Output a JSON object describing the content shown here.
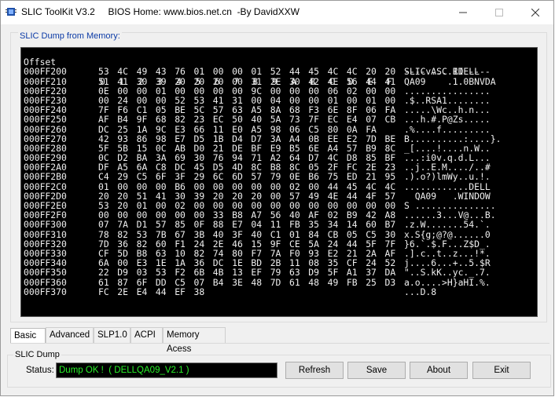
{
  "window": {
    "title": "SLIC ToolKit V3.2     BIOS Home: www.bios.net.cn  -By DavidXXW"
  },
  "dump_group": {
    "label": "SLIC Dump from Memory:"
  },
  "hex": {
    "header": {
      "offset": "Offset",
      "columns": [
        "0",
        "1",
        "2",
        "3",
        "4",
        "5",
        "6",
        "7",
        "8",
        "9",
        "A",
        "B",
        "C",
        "D",
        "E",
        "F"
      ],
      "ascii": "---- ASC II ----"
    },
    "rows": [
      {
        "offset": "000FF200",
        "bytes": [
          "53",
          "4C",
          "49",
          "43",
          "76",
          "01",
          "00",
          "00",
          "01",
          "52",
          "44",
          "45",
          "4C",
          "4C",
          "20",
          "20"
        ],
        "ascii": "SLICv....RDELL"
      },
      {
        "offset": "000FF210",
        "bytes": [
          "51",
          "41",
          "30",
          "39",
          "20",
          "20",
          "20",
          "00",
          "31",
          "2E",
          "30",
          "42",
          "4E",
          "56",
          "44",
          "41"
        ],
        "ascii": "QA09    .1.0BNVDA"
      },
      {
        "offset": "000FF220",
        "bytes": [
          "0E",
          "00",
          "00",
          "01",
          "00",
          "00",
          "00",
          "00",
          "9C",
          "00",
          "00",
          "00",
          "06",
          "02",
          "00",
          "00"
        ],
        "ascii": "................"
      },
      {
        "offset": "000FF230",
        "bytes": [
          "00",
          "24",
          "00",
          "00",
          "52",
          "53",
          "41",
          "31",
          "00",
          "04",
          "00",
          "00",
          "01",
          "00",
          "01",
          "00"
        ],
        "ascii": ".$..RSA1........"
      },
      {
        "offset": "000FF240",
        "bytes": [
          "7F",
          "F6",
          "C1",
          "05",
          "BE",
          "5C",
          "57",
          "63",
          "A5",
          "8A",
          "68",
          "F3",
          "6E",
          "8F",
          "06",
          "FA"
        ],
        "ascii": ".....\\Wc..h.n..."
      },
      {
        "offset": "000FF250",
        "bytes": [
          "AF",
          "B4",
          "9F",
          "68",
          "82",
          "23",
          "EC",
          "50",
          "40",
          "5A",
          "73",
          "7F",
          "EC",
          "E4",
          "07",
          "CB"
        ],
        "ascii": "...h.#.P@Zs....."
      },
      {
        "offset": "000FF260",
        "bytes": [
          "DC",
          "25",
          "1A",
          "9C",
          "E3",
          "66",
          "11",
          "E0",
          "A5",
          "98",
          "06",
          "C5",
          "80",
          "0A",
          "FA"
        ],
        "ascii": ".%....f........."
      },
      {
        "offset": "000FF270",
        "bytes": [
          "42",
          "93",
          "86",
          "98",
          "E7",
          "D5",
          "1B",
          "D4",
          "D7",
          "3A",
          "A4",
          "0B",
          "EE",
          "E2",
          "7D",
          "BE"
        ],
        "ascii": "B..........:....}."
      },
      {
        "offset": "000FF280",
        "bytes": [
          "5F",
          "5B",
          "15",
          "0C",
          "AB",
          "D0",
          "21",
          "DE",
          "BF",
          "E9",
          "B5",
          "6E",
          "A4",
          "57",
          "B9",
          "8C"
        ],
        "ascii": "_[....!....n.W.."
      },
      {
        "offset": "000FF290",
        "bytes": [
          "0C",
          "D2",
          "BA",
          "3A",
          "69",
          "30",
          "76",
          "94",
          "71",
          "A2",
          "64",
          "D7",
          "4C",
          "D8",
          "85",
          "BF"
        ],
        "ascii": "...:i0v.q.d.L..."
      },
      {
        "offset": "000FF2A0",
        "bytes": [
          "DF",
          "A5",
          "6A",
          "C8",
          "DC",
          "45",
          "D5",
          "4D",
          "8C",
          "B8",
          "8C",
          "05",
          "2F",
          "FC",
          "2E",
          "23"
        ],
        "ascii": "..j..E.M..../..#"
      },
      {
        "offset": "000FF2B0",
        "bytes": [
          "C4",
          "29",
          "C5",
          "6F",
          "3F",
          "29",
          "6C",
          "6D",
          "57",
          "79",
          "0E",
          "B6",
          "75",
          "ED",
          "21",
          "95"
        ],
        "ascii": ".).o?)lmWy..u.!."
      },
      {
        "offset": "000FF2C0",
        "bytes": [
          "01",
          "00",
          "00",
          "00",
          "B6",
          "00",
          "00",
          "00",
          "00",
          "00",
          "02",
          "00",
          "44",
          "45",
          "4C",
          "4C"
        ],
        "ascii": "............DELL"
      },
      {
        "offset": "000FF2D0",
        "bytes": [
          "20",
          "20",
          "51",
          "41",
          "30",
          "39",
          "20",
          "20",
          "20",
          "00",
          "57",
          "49",
          "4E",
          "44",
          "4F",
          "57"
        ],
        "ascii": "  QA09   .WINDOW"
      },
      {
        "offset": "000FF2E0",
        "bytes": [
          "53",
          "20",
          "01",
          "00",
          "02",
          "00",
          "00",
          "00",
          "00",
          "00",
          "00",
          "00",
          "00",
          "00",
          "00",
          "00"
        ],
        "ascii": "S ..............."
      },
      {
        "offset": "000FF2F0",
        "bytes": [
          "00",
          "00",
          "00",
          "00",
          "00",
          "00",
          "33",
          "B8",
          "A7",
          "56",
          "40",
          "AF",
          "02",
          "B9",
          "42",
          "A8"
        ],
        "ascii": "......3...V@...B."
      },
      {
        "offset": "000FF300",
        "bytes": [
          "07",
          "7A",
          "D1",
          "57",
          "85",
          "0F",
          "88",
          "E7",
          "04",
          "11",
          "FB",
          "35",
          "34",
          "14",
          "60",
          "B7"
        ],
        "ascii": ".z.W.......54.`."
      },
      {
        "offset": "000FF310",
        "bytes": [
          "78",
          "82",
          "53",
          "7B",
          "67",
          "3B",
          "40",
          "3F",
          "40",
          "C1",
          "01",
          "84",
          "CB",
          "05",
          "C5",
          "30"
        ],
        "ascii": "x.S{g;@?@......0"
      },
      {
        "offset": "000FF320",
        "bytes": [
          "7D",
          "36",
          "82",
          "60",
          "F1",
          "24",
          "2E",
          "46",
          "15",
          "9F",
          "CE",
          "5A",
          "24",
          "44",
          "5F",
          "7F"
        ],
        "ascii": "}6.`.$.F...Z$D_."
      },
      {
        "offset": "000FF330",
        "bytes": [
          "CF",
          "5D",
          "B8",
          "63",
          "10",
          "82",
          "74",
          "80",
          "F7",
          "7A",
          "F0",
          "93",
          "E2",
          "21",
          "2A",
          "AF"
        ],
        "ascii": ".].c..t..z...!*."
      },
      {
        "offset": "000FF340",
        "bytes": [
          "6A",
          "00",
          "E3",
          "1E",
          "1A",
          "36",
          "DC",
          "1E",
          "BD",
          "2B",
          "11",
          "08",
          "35",
          "CF",
          "24",
          "52"
        ],
        "ascii": "j....6...+..5.$R"
      },
      {
        "offset": "000FF350",
        "bytes": [
          "22",
          "D9",
          "03",
          "53",
          "F2",
          "6B",
          "4B",
          "13",
          "EF",
          "79",
          "63",
          "D9",
          "5F",
          "A1",
          "37",
          "DA"
        ],
        "ascii": "\"..S.kK..yc._.7."
      },
      {
        "offset": "000FF360",
        "bytes": [
          "61",
          "87",
          "6F",
          "DD",
          "C5",
          "07",
          "B4",
          "3E",
          "48",
          "7D",
          "61",
          "48",
          "49",
          "FB",
          "25",
          "D3"
        ],
        "ascii": "a.o....>H}aHI.%."
      },
      {
        "offset": "000FF370",
        "bytes": [
          "FC",
          "2E",
          "E4",
          "44",
          "EF",
          "38"
        ],
        "ascii": "...D.8"
      }
    ]
  },
  "tabs": [
    {
      "label": "Basic",
      "active": true
    },
    {
      "label": "Advanced",
      "active": false
    },
    {
      "label": "SLP1.0",
      "active": false
    },
    {
      "label": "ACPI",
      "active": false
    },
    {
      "label": "Memory Acess",
      "active": false
    }
  ],
  "slic_group": {
    "label": "SLIC Dump"
  },
  "status": {
    "label": "Status:",
    "value": "Dump OK !  ( DELLQA09_V2.1 )",
    "color": "#29f229"
  },
  "buttons": {
    "refresh": "Refresh",
    "save": "Save",
    "about": "About",
    "exit": "Exit"
  },
  "icons": {
    "app": "chip-icon",
    "minimize": "minimize-icon",
    "maximize": "maximize-icon",
    "close": "close-icon"
  }
}
